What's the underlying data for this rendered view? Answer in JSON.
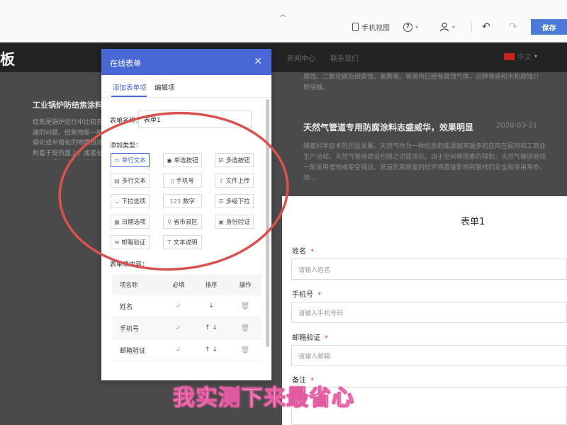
{
  "toolbar": {
    "mobile_view_label": "手机视图",
    "help_icon": "question-circle-icon",
    "user_icon": "user-icon",
    "undo_icon": "undo-icon",
    "redo_icon": "redo-icon",
    "save_label": "保存",
    "save_color": "#4a7bd9"
  },
  "site": {
    "title_fragment": "板",
    "nav": [
      "新闻中心",
      "联系我们"
    ],
    "language": "中文",
    "left_article": {
      "title": "工业锅炉防结焦涂料：",
      "body": "结焦是锅炉运行中比较普遍的问题，结焦物是一种熔化或半熔化的物质迅速附着于受热面上，或者是熔化在受热面上形成结焦层。"
    },
    "right_top_text": "腐蚀、二氧化碳及硫腐蚀，氢脆等。管道内已经有腐蚀气体，这种管道和水和腐蚀介质接触。",
    "news": {
      "title": "天然气管道专用防腐涂料志盛威华，效果明显",
      "date": "2020-03-21",
      "body": "随着科学技术的迅猛发展，天然气作为一种优质的能源越来越多的应用在民用和工商业生产活动，天然气管道建设也随之迅猛增长。由于空间等因素的限制，天然气输送管线一般采用埋地或架空铺设，管道防腐质量的好坏将直接影响到管线的安全和使用寿命，特..."
    }
  },
  "modal": {
    "title": "在线表单",
    "tabs": [
      "添加表单项",
      "编辑项"
    ],
    "form_name_label": "表单名称：",
    "form_name_value": "表单1",
    "types_label": "添加类型：",
    "types": [
      {
        "label": "单行文本",
        "icon": "text-field-icon",
        "active": true
      },
      {
        "label": "单选按钮",
        "icon": "radio-icon",
        "active": false
      },
      {
        "label": "多选按钮",
        "icon": "checkbox-icon",
        "active": false
      },
      {
        "label": "多行文本",
        "icon": "textarea-icon",
        "active": false
      },
      {
        "label": "手机号",
        "icon": "phone-icon",
        "active": false
      },
      {
        "label": "文件上传",
        "icon": "upload-icon",
        "active": false
      },
      {
        "label": "下拉选项",
        "icon": "dropdown-icon",
        "active": false
      },
      {
        "label": "数字",
        "icon": "number-icon",
        "active": false
      },
      {
        "label": "多级下拉",
        "icon": "cascade-icon",
        "active": false
      },
      {
        "label": "日期选项",
        "icon": "calendar-icon",
        "active": false
      },
      {
        "label": "省市县区",
        "icon": "location-icon",
        "active": false
      },
      {
        "label": "身份验证",
        "icon": "id-card-icon",
        "active": false
      },
      {
        "label": "邮箱验证",
        "icon": "mail-icon",
        "active": false
      },
      {
        "label": "文本说明",
        "icon": "text-icon",
        "active": false
      }
    ],
    "items_label": "表单项内容：",
    "table": {
      "headers": [
        "项名称",
        "必填",
        "排序",
        "操作"
      ],
      "rows": [
        {
          "name": "姓名",
          "required": "✓",
          "sort": "↓"
        },
        {
          "name": "手机号",
          "required": "✓",
          "sort": "↑ ↓"
        },
        {
          "name": "邮箱验证",
          "required": "✓",
          "sort": "↑ ↓"
        }
      ]
    }
  },
  "preview": {
    "title": "表单1",
    "fields": [
      {
        "label": "姓名",
        "required": "*",
        "placeholder": "请输入姓名"
      },
      {
        "label": "手机号",
        "required": "*",
        "placeholder": "请输入手机号码"
      },
      {
        "label": "邮箱验证",
        "required": "*",
        "placeholder": "请输入邮箱"
      }
    ],
    "remark_label": "备注",
    "remark_required": "*"
  },
  "caption": "我实测下来最省心",
  "colors": {
    "primary": "#4a67d6",
    "annotation": "#d9524f",
    "caption_outline": "#e15aa0"
  }
}
